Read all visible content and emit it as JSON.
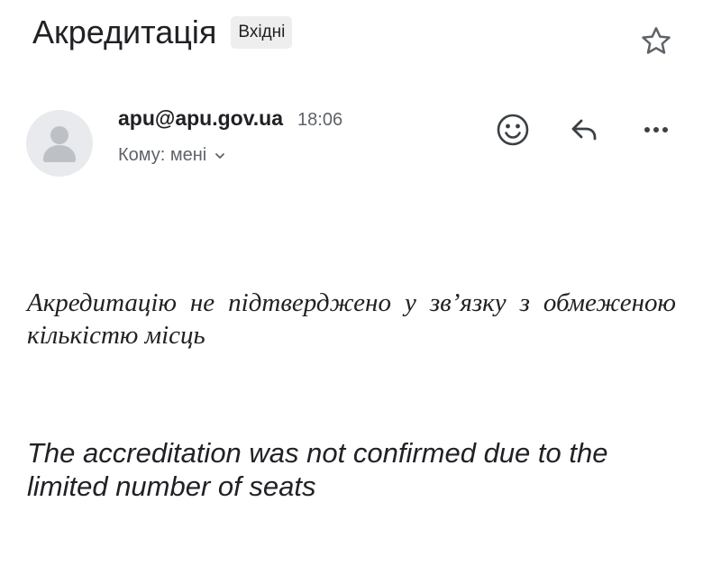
{
  "message": {
    "subject": "Акредитація",
    "label": "Вхідні",
    "sender": "apu@apu.gov.ua",
    "time": "18:06",
    "recipient": "Кому: мені"
  },
  "icons": {
    "star": "star-outline-icon",
    "avatar": "person-icon",
    "recipient_toggle": "chevron-down-icon",
    "reaction": "smiley-icon",
    "reply": "reply-arrow-icon",
    "more": "more-horizontal-icon"
  },
  "body": {
    "ukrainian": "Акредитацію не підтверджено у зв’язку з обмеженою кількістю місць",
    "english": "The accreditation was not confirmed due to the limited number of seats"
  },
  "colors": {
    "text": "#202124",
    "secondary_text": "#5f6368",
    "label_background": "#eeeeee",
    "avatar_background": "#e8eaed",
    "avatar_glyph": "#bdc1c6"
  }
}
